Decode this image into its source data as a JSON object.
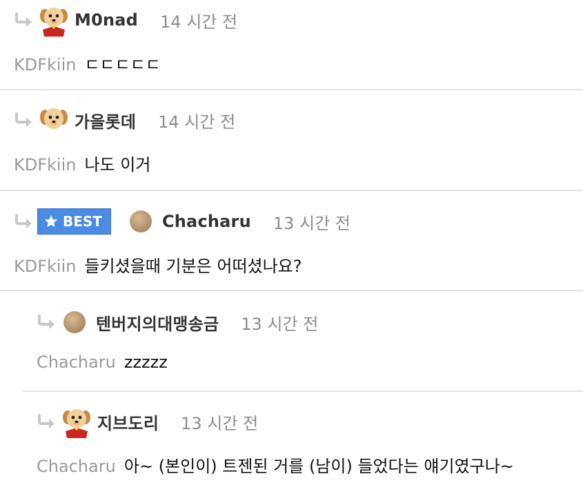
{
  "comments": [
    {
      "nickname": "M0nad",
      "time": "14 시간 전",
      "mention": "KDFkiin",
      "text": "ㄷㄷㄷㄷㄷ"
    },
    {
      "nickname": "가을롯데",
      "time": "14 시간 전",
      "mention": "KDFkiin",
      "text": "나도 이거"
    },
    {
      "badge": "BEST",
      "nickname": "Chacharu",
      "time": "13 시간 전",
      "mention": "KDFkiin",
      "text": "들키셨을때 기분은 어떠셨나요?"
    },
    {
      "nickname": "텐버지의대맹송금",
      "time": "13 시간 전",
      "mention": "Chacharu",
      "text": "zzzzz"
    },
    {
      "nickname": "지브도리",
      "time": "13 시간 전",
      "mention": "Chacharu",
      "text": "아~ (본인이) 트젠된 거를 (남이) 들었다는 얘기였구나~"
    }
  ],
  "icons": {
    "reply": "reply-arrow-icon",
    "avatar_puppy": "puppy-avatar",
    "avatar_dot": "tan-dot-avatar",
    "badge_star": "star-icon"
  },
  "colors": {
    "badge": "#4a8be3",
    "muted": "#8c8c8c",
    "divider": "#e3e3e3"
  }
}
